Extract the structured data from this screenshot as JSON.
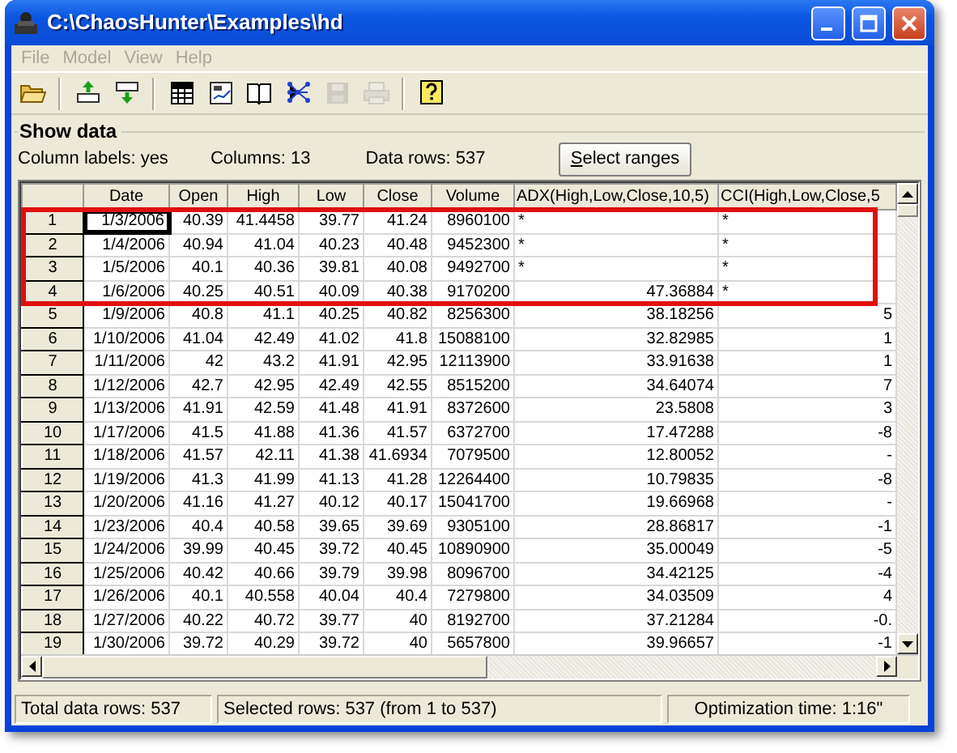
{
  "window": {
    "title": "C:\\ChaosHunter\\Examples\\hd"
  },
  "menu": [
    {
      "label": "File",
      "disabled": true
    },
    {
      "label": "Model",
      "disabled": true
    },
    {
      "label": "View",
      "disabled": true
    },
    {
      "label": "Help",
      "disabled": true
    }
  ],
  "toolbar": [
    {
      "kind": "open",
      "disabled": false
    },
    {
      "kind": "separator"
    },
    {
      "kind": "import",
      "disabled": false
    },
    {
      "kind": "export",
      "disabled": false
    },
    {
      "kind": "separator"
    },
    {
      "kind": "grid",
      "disabled": false
    },
    {
      "kind": "chart",
      "disabled": false
    },
    {
      "kind": "book",
      "disabled": false
    },
    {
      "kind": "network",
      "disabled": false
    },
    {
      "kind": "save",
      "disabled": true
    },
    {
      "kind": "print",
      "disabled": true
    },
    {
      "kind": "separator"
    },
    {
      "kind": "help",
      "disabled": false
    }
  ],
  "group_title": "Show data",
  "info": [
    "Column labels: yes",
    "Columns: 13",
    "Data rows: 537"
  ],
  "select_button": {
    "label": "Select ranges",
    "access_key": true
  },
  "table": {
    "columns": [
      "Date",
      "Open",
      "High",
      "Low",
      "Close",
      "Volume",
      "ADX(High,Low,Close,10,5)",
      "CCI(High,Low,Close,5"
    ],
    "rows": [
      {
        "label": "1",
        "highlighted": true,
        "focused": true,
        "cells": [
          "1/3/2006",
          "40.39",
          "41.4458",
          "39.77",
          "41.24",
          "8960100",
          {
            "text": "*",
            "kind": "placeholder"
          },
          {
            "text": "*",
            "kind": "placeholder"
          }
        ]
      },
      {
        "label": "2",
        "highlighted": true,
        "focused": false,
        "cells": [
          "1/4/2006",
          "40.94",
          "41.04",
          "40.23",
          "40.48",
          "9452300",
          {
            "text": "*",
            "kind": "placeholder"
          },
          {
            "text": "*",
            "kind": "placeholder"
          }
        ]
      },
      {
        "label": "3",
        "highlighted": true,
        "focused": false,
        "cells": [
          "1/5/2006",
          "40.1",
          "40.36",
          "39.81",
          "40.08",
          "9492700",
          {
            "text": "*",
            "kind": "placeholder"
          },
          {
            "text": "*",
            "kind": "placeholder"
          }
        ]
      },
      {
        "label": "4",
        "highlighted": true,
        "focused": false,
        "cells": [
          "1/6/2006",
          "40.25",
          "40.51",
          "40.09",
          "40.38",
          "9170200",
          "47.36884",
          {
            "text": "*",
            "kind": "placeholder"
          }
        ]
      },
      {
        "label": "5",
        "highlighted": false,
        "focused": false,
        "cells": [
          "1/9/2006",
          "40.8",
          "41.1",
          "40.25",
          "40.82",
          "8256300",
          "38.18256",
          "5"
        ]
      },
      {
        "label": "6",
        "highlighted": false,
        "focused": false,
        "cells": [
          "1/10/2006",
          "41.04",
          "42.49",
          "41.02",
          "41.8",
          "15088100",
          "32.82985",
          "1"
        ]
      },
      {
        "label": "7",
        "highlighted": false,
        "focused": false,
        "cells": [
          "1/11/2006",
          "42",
          "43.2",
          "41.91",
          "42.95",
          "12113900",
          "33.91638",
          "1"
        ]
      },
      {
        "label": "8",
        "highlighted": false,
        "focused": false,
        "cells": [
          "1/12/2006",
          "42.7",
          "42.95",
          "42.49",
          "42.55",
          "8515200",
          "34.64074",
          "7"
        ]
      },
      {
        "label": "9",
        "highlighted": false,
        "focused": false,
        "cells": [
          "1/13/2006",
          "41.91",
          "42.59",
          "41.48",
          "41.91",
          "8372600",
          "23.5808",
          "3"
        ]
      },
      {
        "label": "10",
        "highlighted": false,
        "focused": false,
        "cells": [
          "1/17/2006",
          "41.5",
          "41.88",
          "41.36",
          "41.57",
          "6372700",
          "17.47288",
          "-8"
        ]
      },
      {
        "label": "11",
        "highlighted": false,
        "focused": false,
        "cells": [
          "1/18/2006",
          "41.57",
          "42.11",
          "41.38",
          "41.6934",
          "7079500",
          "12.80052",
          "-"
        ]
      },
      {
        "label": "12",
        "highlighted": false,
        "focused": false,
        "cells": [
          "1/19/2006",
          "41.3",
          "41.99",
          "41.13",
          "41.28",
          "12264400",
          "10.79835",
          "-8"
        ]
      },
      {
        "label": "13",
        "highlighted": false,
        "focused": false,
        "cells": [
          "1/20/2006",
          "41.16",
          "41.27",
          "40.12",
          "40.17",
          "15041700",
          "19.66968",
          "-"
        ]
      },
      {
        "label": "14",
        "highlighted": false,
        "focused": false,
        "cells": [
          "1/23/2006",
          "40.4",
          "40.58",
          "39.65",
          "39.69",
          "9305100",
          "28.86817",
          "-1"
        ]
      },
      {
        "label": "15",
        "highlighted": false,
        "focused": false,
        "cells": [
          "1/24/2006",
          "39.99",
          "40.45",
          "39.72",
          "40.45",
          "10890900",
          "35.00049",
          "-5"
        ]
      },
      {
        "label": "16",
        "highlighted": false,
        "focused": false,
        "cells": [
          "1/25/2006",
          "40.42",
          "40.66",
          "39.79",
          "39.98",
          "8096700",
          "34.42125",
          "-4"
        ]
      },
      {
        "label": "17",
        "highlighted": false,
        "focused": false,
        "cells": [
          "1/26/2006",
          "40.1",
          "40.558",
          "40.04",
          "40.4",
          "7279800",
          "34.03509",
          "4"
        ]
      },
      {
        "label": "18",
        "highlighted": false,
        "focused": false,
        "cells": [
          "1/27/2006",
          "40.22",
          "40.72",
          "39.77",
          "40",
          "8192700",
          "37.21284",
          "-0."
        ]
      },
      {
        "label": "19",
        "highlighted": false,
        "focused": false,
        "cells": [
          "1/30/2006",
          "39.72",
          "40.29",
          "39.72",
          "40",
          "5657800",
          "39.96657",
          "-1"
        ]
      }
    ]
  },
  "status_bar": [
    "Total data rows: 537",
    "Selected rows: 537  (from 1 to 537)",
    "Optimization time: 1:16\""
  ]
}
